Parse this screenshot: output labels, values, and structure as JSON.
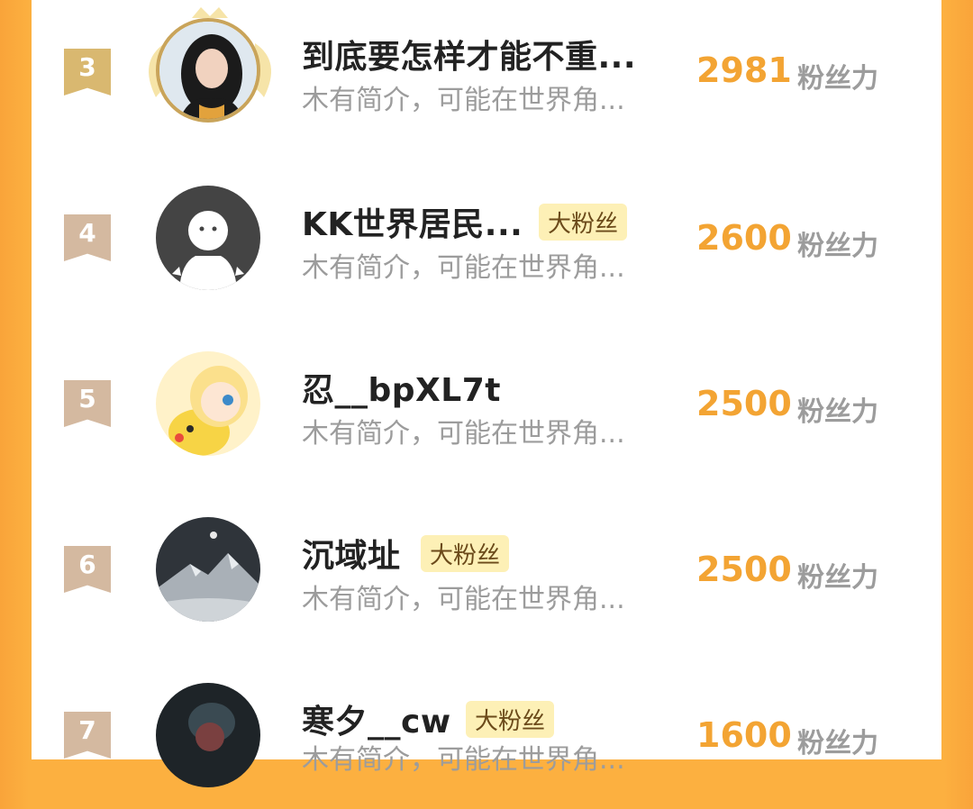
{
  "score_unit": "粉丝力",
  "rows": [
    {
      "rank": "3",
      "name": "到底要怎样才能不重...",
      "badge": "",
      "bio": "木有简介，可能在世界角...",
      "score": "2981",
      "avatar_icon": "user-photo-avatar"
    },
    {
      "rank": "4",
      "name": "KK世界居民...",
      "badge": "大粉丝",
      "bio": "木有简介，可能在世界角...",
      "score": "2600",
      "avatar_icon": "default-ghost-avatar"
    },
    {
      "rank": "5",
      "name": "忍__bpXL7t",
      "badge": "",
      "bio": "木有简介，可能在世界角...",
      "score": "2500",
      "avatar_icon": "anime-avatar"
    },
    {
      "rank": "6",
      "name": "沉域址",
      "badge": "大粉丝",
      "bio": "木有简介，可能在世界角...",
      "score": "2500",
      "avatar_icon": "mountain-night-avatar"
    },
    {
      "rank": "7",
      "name": "寒夕__cw",
      "badge": "大粉丝",
      "bio": "木有简介，可能在世界角...",
      "score": "1600",
      "avatar_icon": "dark-photo-avatar"
    }
  ],
  "colors": {
    "accent_orange": "#f3a433",
    "gold_rank": "#d9b870",
    "tan_rank": "#d4b9a0",
    "badge_bg": "#fdf0b6"
  }
}
